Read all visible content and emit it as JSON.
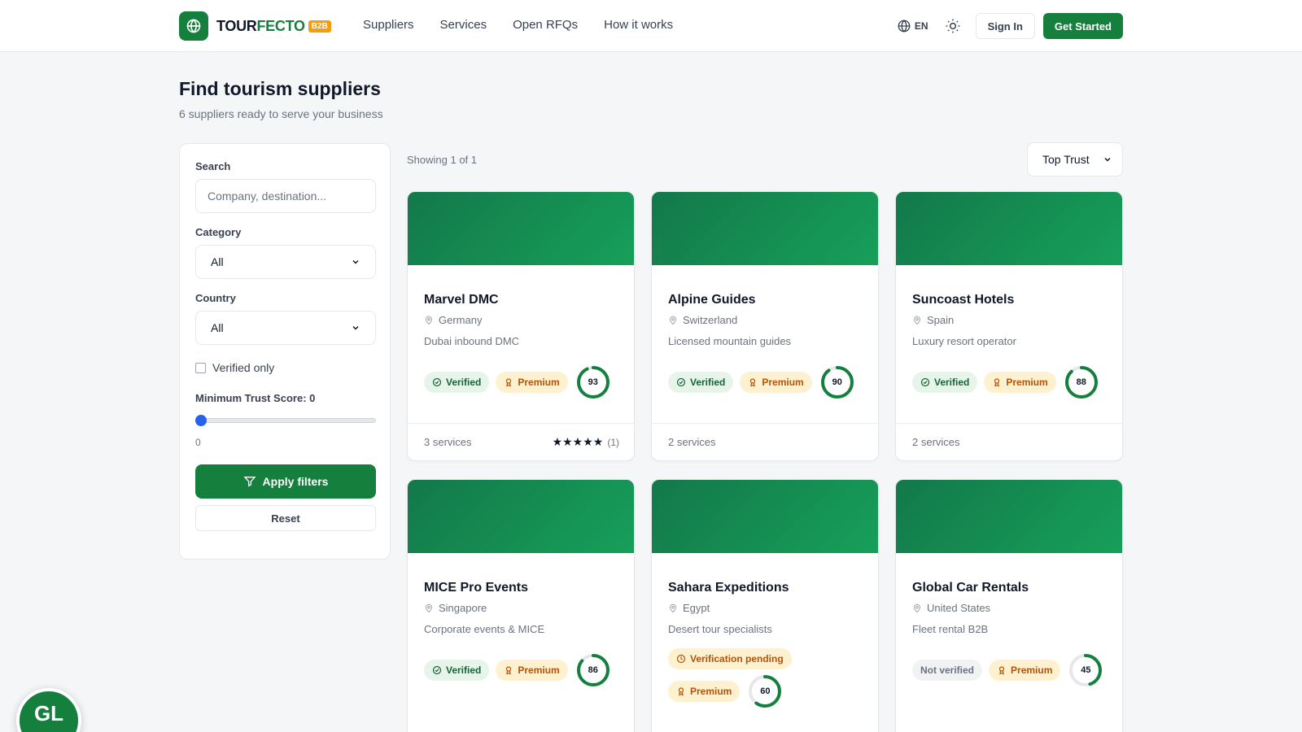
{
  "brand": {
    "name_a": "TOUR",
    "name_b": "FECTO",
    "tag": "B2B",
    "accent": "#15803d"
  },
  "nav": [
    "Suppliers",
    "Services",
    "Open RFQs",
    "How it works"
  ],
  "header": {
    "lang": "EN",
    "signin": "Sign In",
    "get_started": "Get Started"
  },
  "page": {
    "title": "Find tourism suppliers",
    "subtitle": "6 suppliers ready to serve your business"
  },
  "filters": {
    "search_label": "Search",
    "search_placeholder": "Company, destination...",
    "category_label": "Category",
    "category_value": "All",
    "country_label": "Country",
    "country_value": "All",
    "verified_label": "Verified only",
    "trust_label": "Minimum Trust Score: ",
    "trust_value": "0",
    "trust_value_display": "0",
    "apply": "Apply filters",
    "reset": "Reset"
  },
  "results": {
    "showing": "Showing 1 of 1",
    "sort": "Top Trust"
  },
  "cards": [
    {
      "name": "Marvel DMC",
      "country": "Germany",
      "desc": "Dubai inbound DMC",
      "status": "Verified",
      "tier": "Premium",
      "score": 93,
      "services": "3 services",
      "rating_count": "(1)"
    },
    {
      "name": "Alpine Guides",
      "country": "Switzerland",
      "desc": "Licensed mountain guides",
      "status": "Verified",
      "tier": "Premium",
      "score": 90,
      "services": "2 services"
    },
    {
      "name": "Suncoast Hotels",
      "country": "Spain",
      "desc": "Luxury resort operator",
      "status": "Verified",
      "tier": "Premium",
      "score": 88,
      "services": "2 services"
    },
    {
      "name": "MICE Pro Events",
      "country": "Singapore",
      "desc": "Corporate events & MICE",
      "status": "Verified",
      "tier": "Premium",
      "score": 86
    },
    {
      "name": "Sahara Expeditions",
      "country": "Egypt",
      "desc": "Desert tour specialists",
      "status": "Verification pending",
      "tier": "Premium",
      "score": 60
    },
    {
      "name": "Global Car Rentals",
      "country": "United States",
      "desc": "Fleet rental B2B",
      "status": "Not verified",
      "tier": "Premium",
      "score": 45
    }
  ],
  "avatar": {
    "initials": "GL"
  }
}
